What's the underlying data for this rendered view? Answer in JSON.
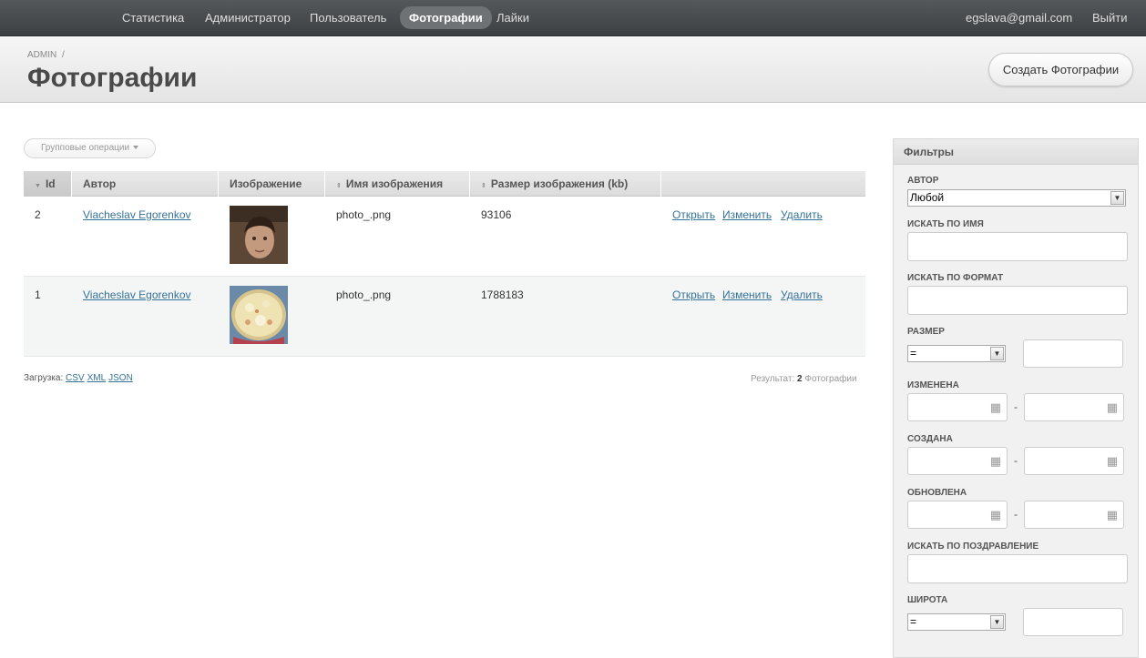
{
  "nav": {
    "items": [
      {
        "label": "Статистика"
      },
      {
        "label": "Администратор"
      },
      {
        "label": "Пользователь"
      },
      {
        "label": "Фотографии"
      },
      {
        "label": "Лайки"
      }
    ],
    "active_index": 3,
    "user_email": "egslava@gmail.com",
    "logout": "Выйти"
  },
  "header": {
    "breadcrumb": "ADMIN",
    "breadcrumb_sep": "/",
    "title": "Фотографии",
    "create_button": "Создать Фотографии"
  },
  "bulk_actions": "Групповые операции",
  "table": {
    "columns": [
      "Id",
      "Автор",
      "Изображение",
      "Имя изображения",
      "Размер изображения (kb)"
    ],
    "rows": [
      {
        "id": "2",
        "author": "Viacheslav Egorenkov",
        "image": "face-photo",
        "name": "photo_.png",
        "size": "93106",
        "actions": [
          "Открыть",
          "Изменить",
          "Удалить"
        ]
      },
      {
        "id": "1",
        "author": "Viacheslav Egorenkov",
        "image": "pizza-photo",
        "name": "photo_.png",
        "size": "1788183",
        "actions": [
          "Открыть",
          "Изменить",
          "Удалить"
        ]
      }
    ]
  },
  "export": {
    "label": "Загрузка:",
    "formats": [
      "CSV",
      "XML",
      "JSON"
    ]
  },
  "result": {
    "prefix": "Результат:",
    "count": "2",
    "suffix": "Фотографии"
  },
  "filters": {
    "title": "Фильтры",
    "author_label": "АВТОР",
    "author_value": "Любой",
    "name_label": "ИСКАТЬ ПО ИМЯ",
    "format_label": "ИСКАТЬ ПО ФОРМАТ",
    "size_label": "РАЗМЕР",
    "size_op": "=",
    "changed_label": "ИЗМЕНЕНА",
    "created_label": "СОЗДАНА",
    "updated_label": "ОБНОВЛЕНА",
    "congrats_label": "ИСКАТЬ ПО ПОЗДРАВЛЕНИЕ",
    "lat_label": "ШИРОТА",
    "lat_op": "=",
    "range_sep": "-",
    "calendar_icon": "calendar-icon",
    "colors": {
      "link": "#35729a",
      "nav_bg": "#4a4d50",
      "header_bg": "#e9e9e9"
    }
  }
}
